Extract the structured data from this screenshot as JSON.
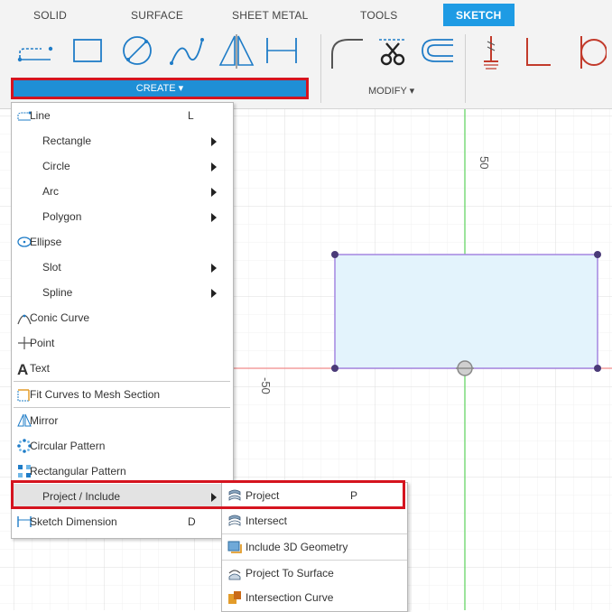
{
  "tabs": [
    {
      "label": "SOLID",
      "active": false
    },
    {
      "label": "SURFACE",
      "active": false
    },
    {
      "label": "SHEET METAL",
      "active": false
    },
    {
      "label": "TOOLS",
      "active": false
    },
    {
      "label": "SKETCH",
      "active": true
    }
  ],
  "toolbar": {
    "create_label": "CREATE ▾",
    "modify_label": "MODIFY ▾",
    "accent_color": "#1f8fd6",
    "highlight_color": "#d5141f",
    "tools": [
      "line-icon",
      "rectangle-icon",
      "circle-icon",
      "spline-icon",
      "mirror-icon",
      "sketch-dimension-icon",
      "fillet-icon",
      "trim-icon",
      "offset-icon",
      "constraint-icon",
      "perpendicular-icon",
      "tangent-icon"
    ]
  },
  "canvas": {
    "label_top": "50",
    "label_left": "-50",
    "rect_fill": "#e3f3fc",
    "rect_stroke": "#a98de2"
  },
  "create_menu": {
    "items": [
      {
        "label": "Line",
        "shortcut": "L",
        "icon": "line-icon",
        "submenu": false
      },
      {
        "label": "Rectangle",
        "shortcut": "",
        "icon": "",
        "submenu": true
      },
      {
        "label": "Circle",
        "shortcut": "",
        "icon": "",
        "submenu": true
      },
      {
        "label": "Arc",
        "shortcut": "",
        "icon": "",
        "submenu": true
      },
      {
        "label": "Polygon",
        "shortcut": "",
        "icon": "",
        "submenu": true
      },
      {
        "label": "Ellipse",
        "shortcut": "",
        "icon": "ellipse-icon",
        "submenu": false
      },
      {
        "label": "Slot",
        "shortcut": "",
        "icon": "",
        "submenu": true
      },
      {
        "label": "Spline",
        "shortcut": "",
        "icon": "",
        "submenu": true
      },
      {
        "label": "Conic Curve",
        "shortcut": "",
        "icon": "conic-curve-icon",
        "submenu": false
      },
      {
        "label": "Point",
        "shortcut": "",
        "icon": "point-icon",
        "submenu": false
      },
      {
        "label": "Text",
        "shortcut": "",
        "icon": "text-icon",
        "submenu": false
      },
      {
        "label": "Fit Curves to Mesh Section",
        "shortcut": "",
        "icon": "fit-curves-icon",
        "submenu": false
      },
      {
        "label": "Mirror",
        "shortcut": "",
        "icon": "mirror-icon",
        "submenu": false
      },
      {
        "label": "Circular Pattern",
        "shortcut": "",
        "icon": "circular-pattern-icon",
        "submenu": false
      },
      {
        "label": "Rectangular Pattern",
        "shortcut": "",
        "icon": "rectangular-pattern-icon",
        "submenu": false
      },
      {
        "label": "Project / Include",
        "shortcut": "",
        "icon": "",
        "submenu": true,
        "highlighted": true
      },
      {
        "label": "Sketch Dimension",
        "shortcut": "D",
        "icon": "sketch-dimension-icon",
        "submenu": false
      }
    ]
  },
  "project_submenu": {
    "items": [
      {
        "label": "Project",
        "shortcut": "P",
        "icon": "project-icon"
      },
      {
        "label": "Intersect",
        "shortcut": "",
        "icon": "intersect-icon"
      },
      {
        "label": "Include 3D Geometry",
        "shortcut": "",
        "icon": "include-3d-geometry-icon"
      },
      {
        "label": "Project To Surface",
        "shortcut": "",
        "icon": "project-to-surface-icon"
      },
      {
        "label": "Intersection Curve",
        "shortcut": "",
        "icon": "intersection-curve-icon"
      }
    ]
  }
}
